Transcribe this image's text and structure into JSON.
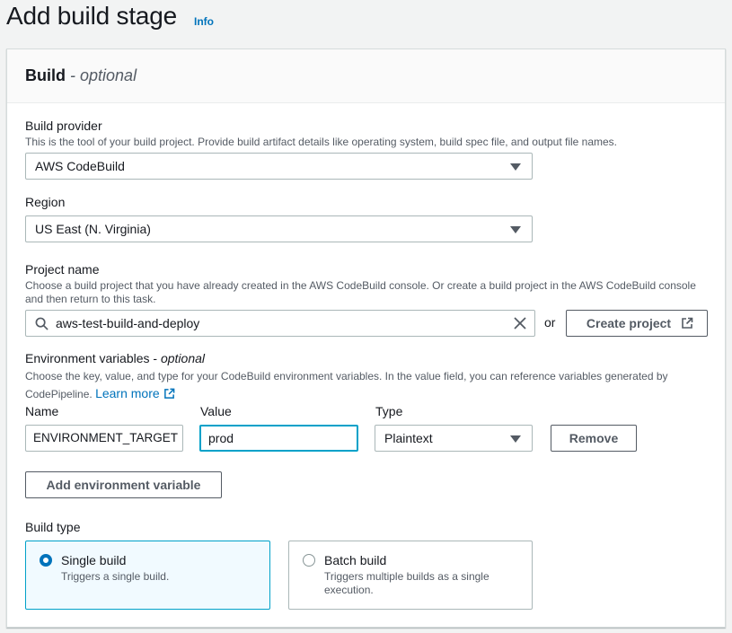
{
  "page": {
    "title": "Add build stage",
    "info_link": "Info"
  },
  "panel": {
    "title": "Build",
    "title_suffix": "optional"
  },
  "build_provider": {
    "label": "Build provider",
    "description": "This is the tool of your build project. Provide build artifact details like operating system, build spec file, and output file names.",
    "value": "AWS CodeBuild"
  },
  "region": {
    "label": "Region",
    "value": "US East (N. Virginia)"
  },
  "project_name": {
    "label": "Project name",
    "description_line1": "Choose a build project that you have already created in the AWS CodeBuild console. Or create a build project in the AWS CodeBuild console",
    "description_line2": "and then return to this task.",
    "value": "aws-test-build-and-deploy",
    "or_text": "or",
    "create_button": "Create project"
  },
  "env_vars": {
    "label": "Environment variables",
    "label_suffix": "optional",
    "description_line1": "Choose the key, value, and type for your CodeBuild environment variables. In the value field, you can reference variables generated by",
    "description_line2": "CodePipeline.",
    "learn_more": "Learn more",
    "col_name": "Name",
    "col_value": "Value",
    "col_type": "Type",
    "row": {
      "name": "ENVIRONMENT_TARGET",
      "value": "prod",
      "type": "Plaintext"
    },
    "remove_button": "Remove",
    "add_button": "Add environment variable"
  },
  "build_type": {
    "label": "Build type",
    "options": [
      {
        "title": "Single build",
        "description": "Triggers a single build.",
        "selected": true
      },
      {
        "title": "Batch build",
        "description": "Triggers multiple builds as a single execution.",
        "selected": false
      }
    ]
  },
  "colors": {
    "link": "#0073bb",
    "focus": "#00a1c9",
    "selected_bg": "#f1faff"
  },
  "icons": [
    "search-icon",
    "clear-icon",
    "external-link-icon",
    "caret-down-icon"
  ]
}
